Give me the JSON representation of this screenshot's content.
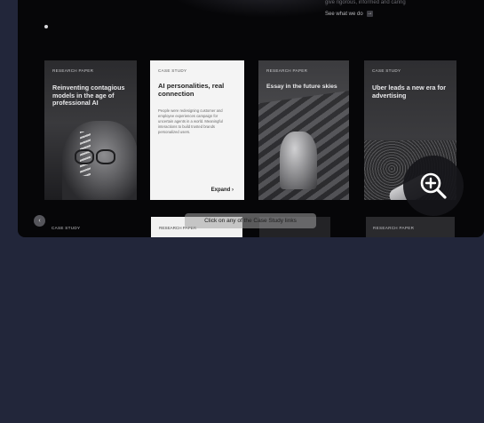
{
  "header": {
    "top_text": "give rigorous, informed and caring",
    "link_label": "See what we do",
    "link_arrow": "→"
  },
  "cards": [
    {
      "tag": "Research Paper",
      "title": "Reinventing contagious models in the age of professional AI"
    },
    {
      "tag": "Case Study",
      "title": "AI personalities, real connection",
      "desc": "People were redesigning customer and employee experiences campaign for uncertain agents in a world. Meaningful interactions to build trusted brands personalized users.",
      "expand_label": "Expand"
    },
    {
      "tag": "Research Paper",
      "title": "Essay in the future skies"
    },
    {
      "tag": "Case Study",
      "title": "Uber leads a new era for advertising"
    }
  ],
  "tooltip": "Click on any of the Case Study links",
  "bottom_row": {
    "left_tag": "Case Study",
    "middle_tag": "Research Paper",
    "right_tag": "Research Paper",
    "nav_glyph": "‹"
  },
  "icons": {
    "zoom": "zoom-in-icon"
  }
}
